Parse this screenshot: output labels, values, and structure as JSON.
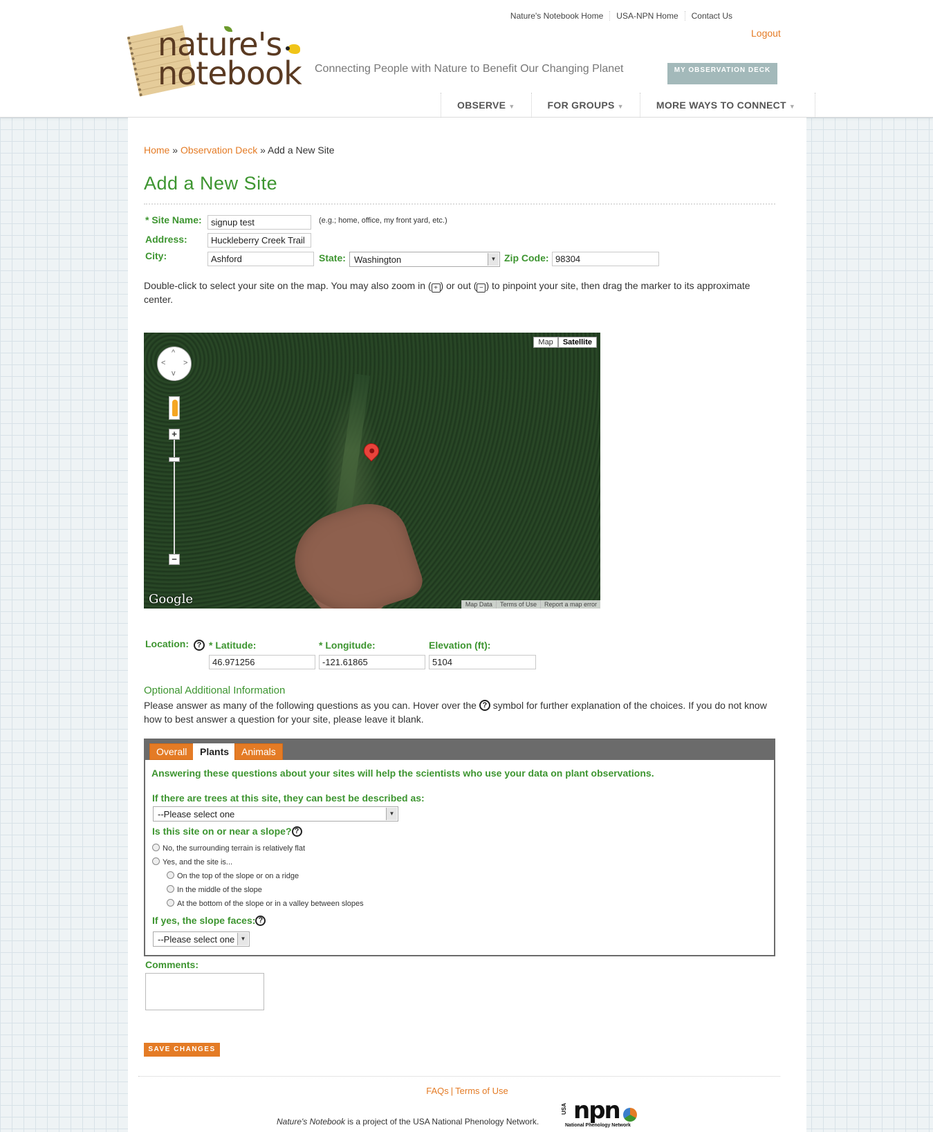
{
  "top_links": [
    "Nature's Notebook Home",
    "USA-NPN Home",
    "Contact Us"
  ],
  "logout": "Logout",
  "logo": {
    "line1": "nature's",
    "line2": "notebook"
  },
  "tagline": "Connecting People with Nature to Benefit Our Changing Planet",
  "obs_deck_button": "MY OBSERVATION DECK",
  "nav": [
    {
      "label": "OBSERVE",
      "caret": "▼"
    },
    {
      "label": "FOR GROUPS",
      "caret": "▼"
    },
    {
      "label": "MORE WAYS TO CONNECT",
      "caret": "▼"
    }
  ],
  "breadcrumb": {
    "home": "Home",
    "sep": "»",
    "deck": "Observation Deck",
    "current": "Add a New Site"
  },
  "page_title": "Add a New Site",
  "form": {
    "site_name_label": "* Site Name:",
    "site_name_value": "signup test",
    "site_name_hint": "(e.g.; home, office, my front yard, etc.)",
    "address_label": "Address:",
    "address_value": "Huckleberry Creek Trail",
    "city_label": "City:",
    "city_value": "Ashford",
    "state_label": "State:",
    "state_value": "Washington",
    "zip_label": "Zip Code:",
    "zip_value": "98304"
  },
  "map_instructions": {
    "part1": "Double-click to select your site on the map. You may also zoom in (",
    "plus": "+",
    "part2": ") or out (",
    "minus": "−",
    "part3": ") to pinpoint your site, then drag the marker to its approximate center."
  },
  "map": {
    "type_map": "Map",
    "type_satellite": "Satellite",
    "google": "Google",
    "footer": [
      "Map Data",
      "Terms of Use",
      "Report a map error"
    ]
  },
  "location": {
    "label": "Location:",
    "help": "?",
    "lat_label": "* Latitude:",
    "lat_value": "46.971256",
    "lon_label": "* Longitude:",
    "lon_value": "-121.61865",
    "elev_label": "Elevation (ft):",
    "elev_value": "5104"
  },
  "optional": {
    "title": "Optional Additional Information",
    "text1": "Please answer as many of the following questions as you can. Hover over the",
    "text2": "symbol for further explanation of the choices. If you do not know how to best answer a question for your site, please leave it blank."
  },
  "tabs": [
    "Overall",
    "Plants",
    "Animals"
  ],
  "plants": {
    "intro": "Answering these questions about your sites will help the scientists who use your data on plant observations.",
    "trees_q": "If there are trees at this site, they can best be described as:",
    "trees_select": "--Please select one",
    "slope_q": "Is this site on or near a slope?",
    "slope_options": [
      "No, the surrounding terrain is relatively flat",
      "Yes, and the site is...",
      "On the top of the slope or on a ridge",
      "In the middle of the slope",
      "At the bottom of the slope or in a valley between slopes"
    ],
    "faces_q": "If yes, the slope faces:",
    "faces_select": "--Please select one"
  },
  "comments_label": "Comments:",
  "save_button": "SAVE CHANGES",
  "footer": {
    "faqs": "FAQs",
    "sep": "|",
    "terms": "Terms of Use",
    "note_italic": "Nature's Notebook",
    "note_rest": " is a project of the USA National Phenology Network.",
    "npn": "npn",
    "usa": "USA",
    "npn_small": "National Phenology Network"
  }
}
